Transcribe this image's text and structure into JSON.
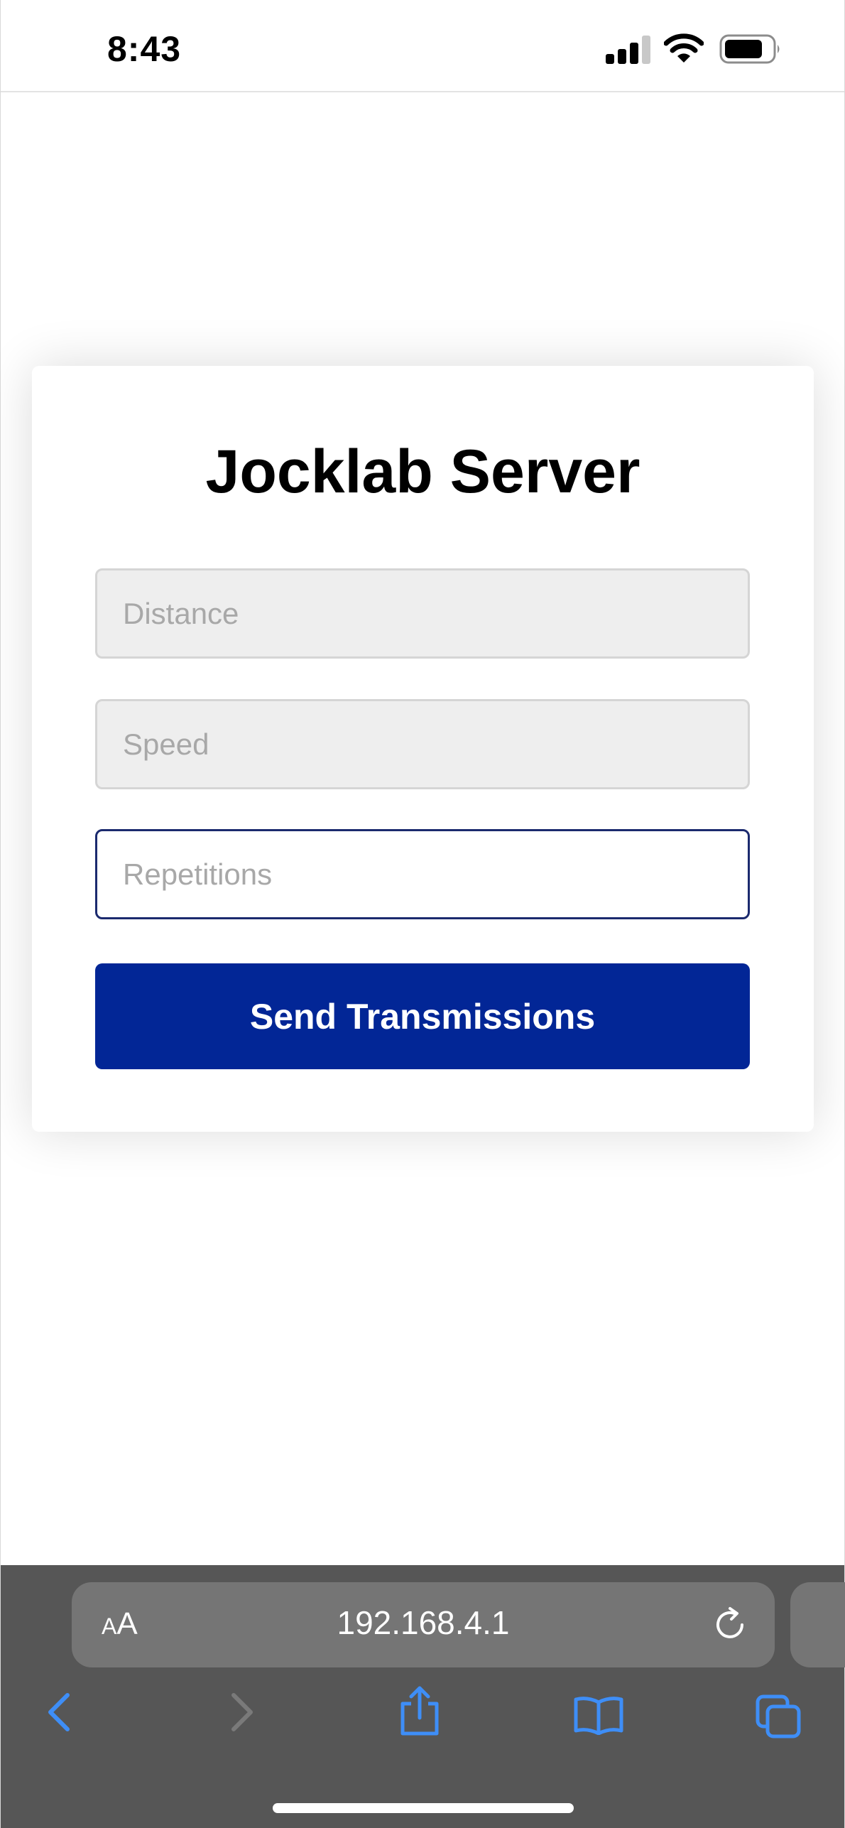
{
  "status_bar": {
    "time": "8:43"
  },
  "card": {
    "title": "Jocklab Server",
    "fields": {
      "distance": {
        "placeholder": "Distance",
        "value": ""
      },
      "speed": {
        "placeholder": "Speed",
        "value": ""
      },
      "repetitions": {
        "placeholder": "Repetitions",
        "value": ""
      }
    },
    "send_button": "Send Transmissions"
  },
  "browser": {
    "text_size_label": {
      "small": "A",
      "big": "A"
    },
    "url": "192.168.4.1"
  },
  "colors": {
    "button": "#022696",
    "focus_border": "#1b2a6e",
    "toolbar_icon": "#3e8ef7",
    "toolbar_icon_disabled": "#7a7a7a",
    "browser_bar": "#565656"
  },
  "icons": [
    "cellular-signal-icon",
    "wifi-icon",
    "battery-icon",
    "reload-icon",
    "back-icon",
    "forward-icon",
    "share-icon",
    "bookmarks-icon",
    "tabs-icon"
  ]
}
